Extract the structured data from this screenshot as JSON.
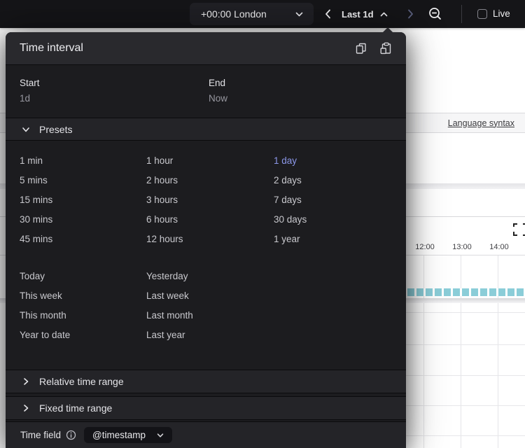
{
  "topbar": {
    "timezone": {
      "label": "+00:00 London"
    },
    "range": {
      "label": "Last 1d"
    },
    "live": {
      "label": "Live"
    }
  },
  "panel": {
    "title": "Time interval",
    "start": {
      "label": "Start",
      "value": "1d"
    },
    "end": {
      "label": "End",
      "value": "Now"
    },
    "presets": {
      "header": "Presets",
      "selected": "1 day",
      "grid": [
        [
          "1 min",
          "1 hour",
          "1 day"
        ],
        [
          "5 mins",
          "2 hours",
          "2 days"
        ],
        [
          "15 mins",
          "3 hours",
          "7 days"
        ],
        [
          "30 mins",
          "6 hours",
          "30 days"
        ],
        [
          "45 mins",
          "12 hours",
          "1 year"
        ]
      ],
      "named": [
        [
          "Today",
          "Yesterday"
        ],
        [
          "This week",
          "Last week"
        ],
        [
          "This month",
          "Last month"
        ],
        [
          "Year to date",
          "Last year"
        ]
      ]
    },
    "relative_section": {
      "label": "Relative time range"
    },
    "fixed_section": {
      "label": "Fixed time range"
    },
    "time_field": {
      "label": "Time field",
      "value": "@timestamp"
    }
  },
  "background": {
    "language_syntax": "Language syntax",
    "ticks": [
      "12:00",
      "13:00",
      "14:00"
    ]
  },
  "colors": {
    "accent": "#8b97e8",
    "teal_bar": "#8bcdd8",
    "panel_bg": "#1c1c1f",
    "section_bar_bg": "#242428",
    "header_bg": "#29292d",
    "topbar_bg": "#151518"
  }
}
